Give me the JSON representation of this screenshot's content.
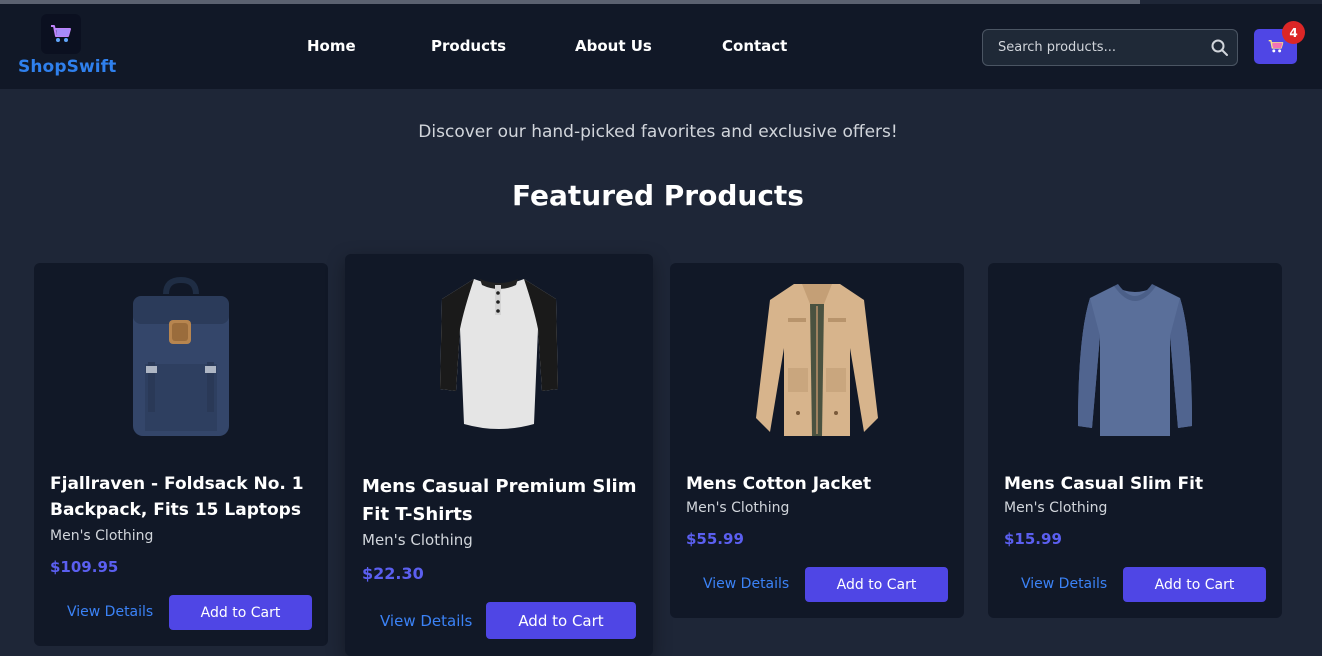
{
  "brand": {
    "name": "ShopSwift",
    "logo_icon": "shopping-cart-icon"
  },
  "nav": [
    {
      "label": "Home"
    },
    {
      "label": "Products"
    },
    {
      "label": "About Us"
    },
    {
      "label": "Contact"
    }
  ],
  "search": {
    "placeholder": "Search products...",
    "value": "",
    "icon": "search-icon"
  },
  "cart": {
    "icon": "shopping-cart-icon",
    "count": "4"
  },
  "hero": {
    "subtitle": "Discover our hand-picked favorites and exclusive offers!",
    "title": "Featured Products"
  },
  "products": [
    {
      "title": "Fjallraven - Foldsack No. 1 Backpack, Fits 15 Laptops",
      "category": "Men's Clothing",
      "price": "$109.95",
      "image": "backpack-image",
      "view_label": "View Details",
      "cart_label": "Add to Cart"
    },
    {
      "title": "Mens Casual Premium Slim Fit T-Shirts",
      "category": "Men's Clothing",
      "price": "$22.30",
      "image": "raglan-tshirt-image",
      "view_label": "View Details",
      "cart_label": "Add to Cart"
    },
    {
      "title": "Mens Cotton Jacket",
      "category": "Men's Clothing",
      "price": "$55.99",
      "image": "cotton-jacket-image",
      "view_label": "View Details",
      "cart_label": "Add to Cart"
    },
    {
      "title": "Mens Casual Slim Fit",
      "category": "Men's Clothing",
      "price": "$15.99",
      "image": "longsleeve-shirt-image",
      "view_label": "View Details",
      "cart_label": "Add to Cart"
    }
  ],
  "colors": {
    "background": "#1e2637",
    "header": "#111827",
    "card": "#111827",
    "accent": "#4f46e5",
    "brand": "#2f80ed",
    "price": "#5b5ff0",
    "link": "#3b82f6",
    "badge": "#dc2626"
  }
}
